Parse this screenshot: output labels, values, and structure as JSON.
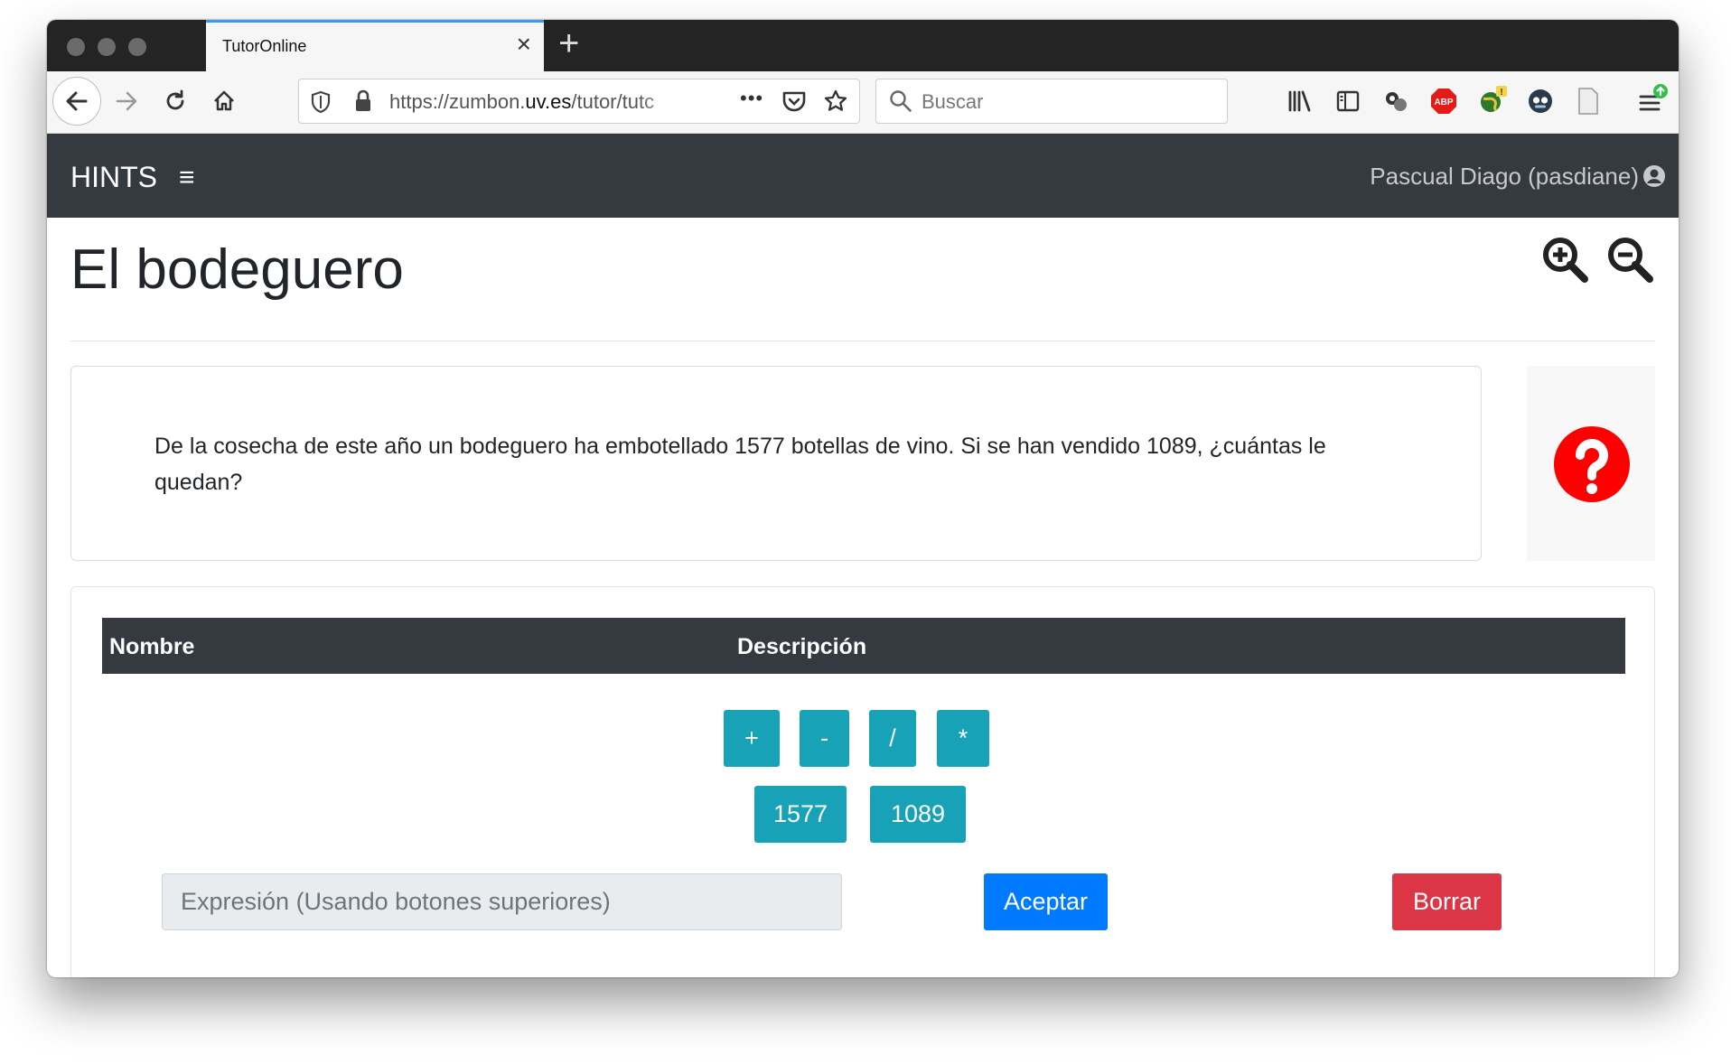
{
  "browser": {
    "tab_title": "TutorOnline",
    "tab_close": "×",
    "new_tab": "+",
    "url_prefix": "https://zumbon.",
    "url_domain": "uv.es",
    "url_path": "/tutor/tutc",
    "page_actions": "•••",
    "search_placeholder": "Buscar"
  },
  "app": {
    "brand": "HINTS",
    "menu_icon": "≡",
    "user_name": "Pascual Diago (pasdiane)"
  },
  "page": {
    "title": "El bodeguero",
    "problem_text": "De la cosecha de este año un bodeguero ha embotellado 1577 botellas de vino. Si se han vendido 1089, ¿cuántas le quedan?"
  },
  "table": {
    "headers": [
      "Nombre",
      "Descripción"
    ]
  },
  "operators": [
    "+",
    "-",
    "/",
    "*"
  ],
  "numbers": [
    "1577",
    "1089"
  ],
  "expression": {
    "placeholder": "Expresión (Usando botones superiores)"
  },
  "actions": {
    "accept": "Aceptar",
    "clear": "Borrar"
  },
  "colors": {
    "appbar": "#343a40",
    "teal": "#17a2b8",
    "primary": "#007bff",
    "danger": "#dc3545",
    "help_red": "#ff0000"
  }
}
